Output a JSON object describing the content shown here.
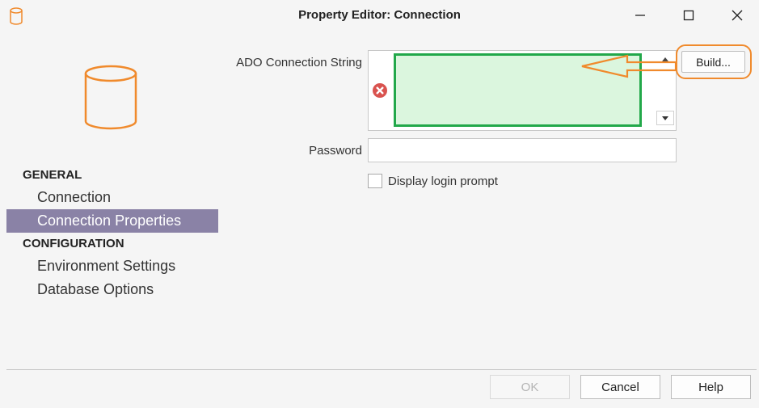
{
  "window": {
    "title": "Property Editor:  Connection",
    "app_icon": "database-icon",
    "controls": [
      "minimize-icon",
      "maximize-icon",
      "close-icon"
    ]
  },
  "sidebar": {
    "icon": "database-icon",
    "sections": [
      {
        "header": "GENERAL",
        "items": [
          {
            "label": "Connection",
            "selected": false
          },
          {
            "label": "Connection Properties",
            "selected": true
          }
        ]
      },
      {
        "header": "CONFIGURATION",
        "items": [
          {
            "label": "Environment Settings",
            "selected": false
          },
          {
            "label": "Database Options",
            "selected": false
          }
        ]
      }
    ]
  },
  "form": {
    "ado_label": "ADO Connection String",
    "ado_value": "",
    "ado_status_icon": "error-icon",
    "build_label": "Build...",
    "password_label": "Password",
    "password_value": "",
    "display_login_prompt_label": "Display login prompt",
    "display_login_prompt_checked": false
  },
  "footer": {
    "ok_label": "OK",
    "ok_enabled": false,
    "cancel_label": "Cancel",
    "help_label": "Help"
  },
  "colors": {
    "accent_orange": "#f08a2c",
    "selection": "#8a82a6",
    "valid_green": "#22a84a",
    "field_green": "#dbf6de",
    "error_red": "#d9534f"
  }
}
